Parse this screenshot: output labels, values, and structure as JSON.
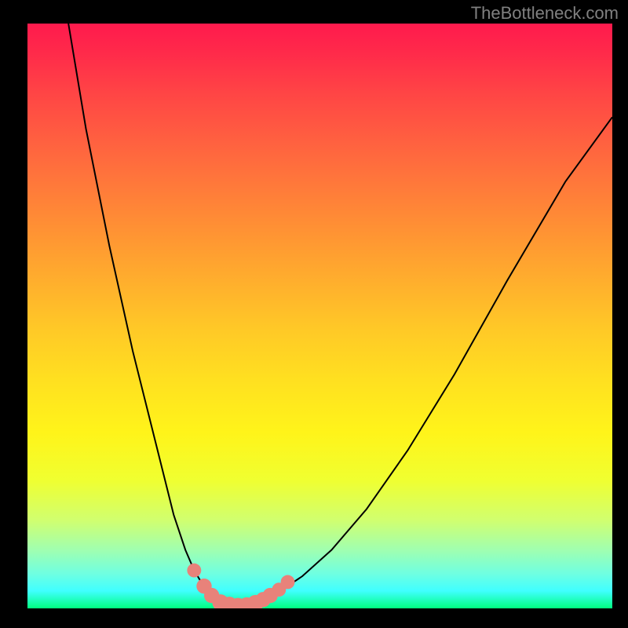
{
  "watermark": "TheBottleneck.com",
  "chart_data": {
    "type": "line",
    "title": "",
    "xlabel": "",
    "ylabel": "",
    "xlim": [
      0,
      100
    ],
    "ylim": [
      0,
      100
    ],
    "series": [
      {
        "name": "left-curve",
        "x": [
          7,
          10,
          14,
          18,
          22,
          25,
          27,
          28.5,
          30,
          31.5,
          33,
          34.2
        ],
        "values": [
          100,
          82,
          62,
          44,
          28,
          16,
          10,
          6.5,
          4,
          2.2,
          1.1,
          0.6
        ]
      },
      {
        "name": "right-curve",
        "x": [
          38.5,
          40,
          42,
          44,
          47,
          52,
          58,
          65,
          73,
          82,
          92,
          100
        ],
        "values": [
          0.6,
          1.2,
          2.2,
          3.5,
          5.5,
          10,
          17,
          27,
          40,
          56,
          73,
          84
        ]
      },
      {
        "name": "valley-floor",
        "x": [
          34.2,
          35.5,
          37,
          38.5
        ],
        "values": [
          0.6,
          0.4,
          0.4,
          0.6
        ]
      }
    ],
    "markers": [
      {
        "x": 28.5,
        "y": 6.5,
        "r": 1.2
      },
      {
        "x": 30.2,
        "y": 3.8,
        "r": 1.3
      },
      {
        "x": 31.5,
        "y": 2.2,
        "r": 1.3
      },
      {
        "x": 33.0,
        "y": 1.0,
        "r": 1.4
      },
      {
        "x": 34.5,
        "y": 0.6,
        "r": 1.4
      },
      {
        "x": 36.0,
        "y": 0.4,
        "r": 1.4
      },
      {
        "x": 37.5,
        "y": 0.5,
        "r": 1.4
      },
      {
        "x": 39.0,
        "y": 0.9,
        "r": 1.4
      },
      {
        "x": 40.3,
        "y": 1.5,
        "r": 1.3
      },
      {
        "x": 41.5,
        "y": 2.2,
        "r": 1.3
      },
      {
        "x": 43.0,
        "y": 3.2,
        "r": 1.2
      },
      {
        "x": 44.5,
        "y": 4.5,
        "r": 1.2
      }
    ],
    "colors": {
      "curve": "#000000",
      "marker": "#e8827a",
      "gradient_top": "#ff1a4d",
      "gradient_bottom": "#00ff80"
    }
  }
}
